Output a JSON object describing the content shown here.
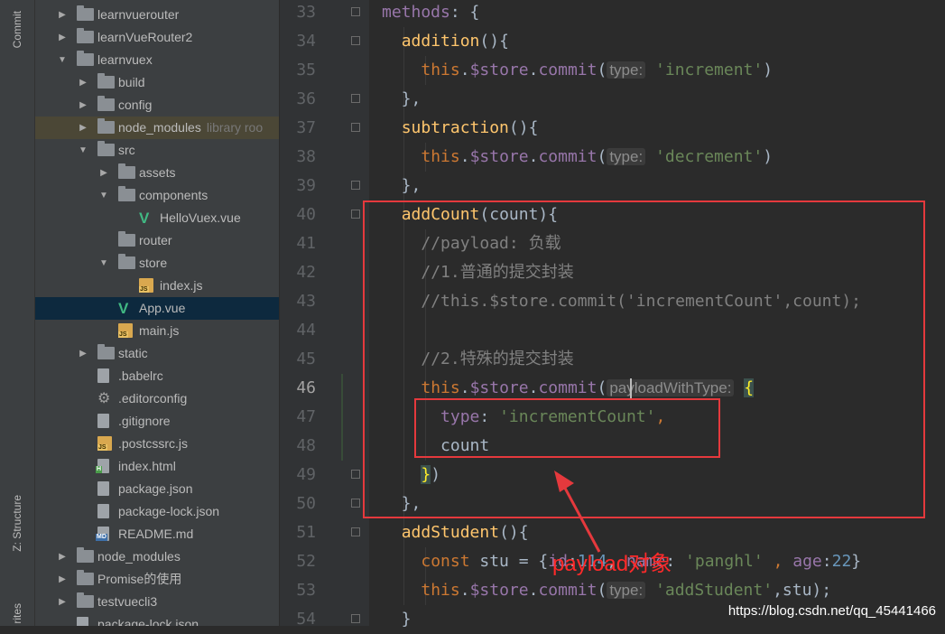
{
  "side_tabs": {
    "commit": "Commit",
    "structure": "Z: Structure",
    "favorites": "rites"
  },
  "tree": [
    {
      "name": "learnvuerouter",
      "type": "folder",
      "depth": 0,
      "arrow": "right"
    },
    {
      "name": "learnVueRouter2",
      "type": "folder",
      "depth": 0,
      "arrow": "right"
    },
    {
      "name": "learnvuex",
      "type": "folder",
      "depth": 0,
      "arrow": "down"
    },
    {
      "name": "build",
      "type": "folder",
      "depth": 1,
      "arrow": "right"
    },
    {
      "name": "config",
      "type": "folder",
      "depth": 1,
      "arrow": "right"
    },
    {
      "name": "node_modules",
      "type": "folder",
      "depth": 1,
      "arrow": "right",
      "note": "library roo",
      "dim": true
    },
    {
      "name": "src",
      "type": "folder",
      "depth": 1,
      "arrow": "down"
    },
    {
      "name": "assets",
      "type": "folder",
      "depth": 2,
      "arrow": "right"
    },
    {
      "name": "components",
      "type": "folder",
      "depth": 2,
      "arrow": "down"
    },
    {
      "name": "HelloVuex.vue",
      "type": "vue",
      "depth": 3
    },
    {
      "name": "router",
      "type": "folder",
      "depth": 2
    },
    {
      "name": "store",
      "type": "folder",
      "depth": 2,
      "arrow": "down"
    },
    {
      "name": "index.js",
      "type": "js",
      "depth": 3
    },
    {
      "name": "App.vue",
      "type": "vue",
      "depth": 2,
      "selected": true
    },
    {
      "name": "main.js",
      "type": "js",
      "depth": 2
    },
    {
      "name": "static",
      "type": "folder",
      "depth": 1,
      "arrow": "right"
    },
    {
      "name": ".babelrc",
      "type": "file",
      "depth": 1
    },
    {
      "name": ".editorconfig",
      "type": "gear",
      "depth": 1
    },
    {
      "name": ".gitignore",
      "type": "file",
      "depth": 1
    },
    {
      "name": ".postcssrc.js",
      "type": "js",
      "depth": 1
    },
    {
      "name": "index.html",
      "type": "html",
      "depth": 1
    },
    {
      "name": "package.json",
      "type": "file",
      "depth": 1
    },
    {
      "name": "package-lock.json",
      "type": "file",
      "depth": 1
    },
    {
      "name": "README.md",
      "type": "md",
      "depth": 1
    },
    {
      "name": "node_modules",
      "type": "folder",
      "depth": 0,
      "arrow": "right"
    },
    {
      "name": "Promise的使用",
      "type": "folder",
      "depth": 0,
      "arrow": "right"
    },
    {
      "name": "testvuecli3",
      "type": "folder",
      "depth": 0,
      "arrow": "right"
    },
    {
      "name": "package-lock.json",
      "type": "file",
      "depth": 0
    }
  ],
  "line_numbers": [
    "33",
    "34",
    "35",
    "36",
    "37",
    "38",
    "39",
    "40",
    "41",
    "42",
    "43",
    "44",
    "45",
    "46",
    "47",
    "48",
    "49",
    "50",
    "51",
    "52",
    "53",
    "54"
  ],
  "current_line": "46",
  "code": [
    [
      {
        "t": "methods",
        "c": "prop"
      },
      {
        "t": ": {",
        "c": "p"
      }
    ],
    [
      {
        "t": "  "
      },
      {
        "t": "addition",
        "c": "fn"
      },
      {
        "t": "(){"
      }
    ],
    [
      {
        "t": "    "
      },
      {
        "t": "this",
        "c": "kw"
      },
      {
        "t": "."
      },
      {
        "t": "$store",
        "c": "prop"
      },
      {
        "t": "."
      },
      {
        "t": "commit",
        "c": "prop"
      },
      {
        "t": "("
      },
      {
        "t": "type:",
        "c": "hint"
      },
      {
        "t": " "
      },
      {
        "t": "'increment'",
        "c": "str"
      },
      {
        "t": ")"
      }
    ],
    [
      {
        "t": "  },"
      },
      {
        "t": "",
        "c": ""
      }
    ],
    [
      {
        "t": "  "
      },
      {
        "t": "subtraction",
        "c": "fn"
      },
      {
        "t": "(){"
      }
    ],
    [
      {
        "t": "    "
      },
      {
        "t": "this",
        "c": "kw"
      },
      {
        "t": "."
      },
      {
        "t": "$store",
        "c": "prop"
      },
      {
        "t": "."
      },
      {
        "t": "commit",
        "c": "prop"
      },
      {
        "t": "("
      },
      {
        "t": "type:",
        "c": "hint"
      },
      {
        "t": " "
      },
      {
        "t": "'decrement'",
        "c": "str"
      },
      {
        "t": ")"
      }
    ],
    [
      {
        "t": "  },"
      }
    ],
    [
      {
        "t": "  "
      },
      {
        "t": "addCount",
        "c": "fn"
      },
      {
        "t": "(count){"
      }
    ],
    [
      {
        "t": "    "
      },
      {
        "t": "//payload: 负载",
        "c": "cm"
      }
    ],
    [
      {
        "t": "    "
      },
      {
        "t": "//1.普通的提交封装",
        "c": "cm"
      }
    ],
    [
      {
        "t": "    "
      },
      {
        "t": "//this.$store.commit('incrementCount',count);",
        "c": "cm"
      }
    ],
    [
      {
        "t": ""
      }
    ],
    [
      {
        "t": "    "
      },
      {
        "t": "//2.特殊的提交封装",
        "c": "cm"
      }
    ],
    [
      {
        "t": "    "
      },
      {
        "t": "this",
        "c": "kw"
      },
      {
        "t": "."
      },
      {
        "t": "$store",
        "c": "prop"
      },
      {
        "t": "."
      },
      {
        "t": "commit",
        "c": "prop"
      },
      {
        "t": "("
      },
      {
        "t": "payloadWithType:",
        "c": "hint"
      },
      {
        "t": " "
      },
      {
        "t": "{",
        "c": "brace"
      }
    ],
    [
      {
        "t": "      "
      },
      {
        "t": "type",
        "c": "prop"
      },
      {
        "t": ": "
      },
      {
        "t": "'incrementCount'",
        "c": "str"
      },
      {
        "t": ",",
        "c": "kw"
      }
    ],
    [
      {
        "t": "      count"
      }
    ],
    [
      {
        "t": "    "
      },
      {
        "t": "}",
        "c": "brace"
      },
      {
        "t": ")"
      }
    ],
    [
      {
        "t": "  },"
      }
    ],
    [
      {
        "t": "  "
      },
      {
        "t": "addStudent",
        "c": "fn"
      },
      {
        "t": "(){"
      }
    ],
    [
      {
        "t": "    "
      },
      {
        "t": "const",
        "c": "kw"
      },
      {
        "t": " stu = {"
      },
      {
        "t": "id",
        "c": "prop"
      },
      {
        "t": ":"
      },
      {
        "t": "114",
        "c": "num"
      },
      {
        "t": ", "
      },
      {
        "t": "name",
        "c": "prop"
      },
      {
        "t": ": "
      },
      {
        "t": "'panghl'",
        "c": "str"
      },
      {
        "t": " , ",
        "c": "kw"
      },
      {
        "t": "age",
        "c": "prop"
      },
      {
        "t": ":"
      },
      {
        "t": "22",
        "c": "num"
      },
      {
        "t": "}"
      }
    ],
    [
      {
        "t": "    "
      },
      {
        "t": "this",
        "c": "kw"
      },
      {
        "t": "."
      },
      {
        "t": "$store",
        "c": "prop"
      },
      {
        "t": "."
      },
      {
        "t": "commit",
        "c": "prop"
      },
      {
        "t": "("
      },
      {
        "t": "type:",
        "c": "hint"
      },
      {
        "t": " "
      },
      {
        "t": "'addStudent'",
        "c": "str"
      },
      {
        "t": ",stu);"
      }
    ],
    [
      {
        "t": "  }"
      }
    ]
  ],
  "annotation": "payload对象",
  "watermark": "https://blog.csdn.net/qq_45441466",
  "colors": {
    "annotation_red": "#e5393d",
    "editor_bg": "#2b2b2b",
    "tree_bg": "#3c3f41"
  }
}
